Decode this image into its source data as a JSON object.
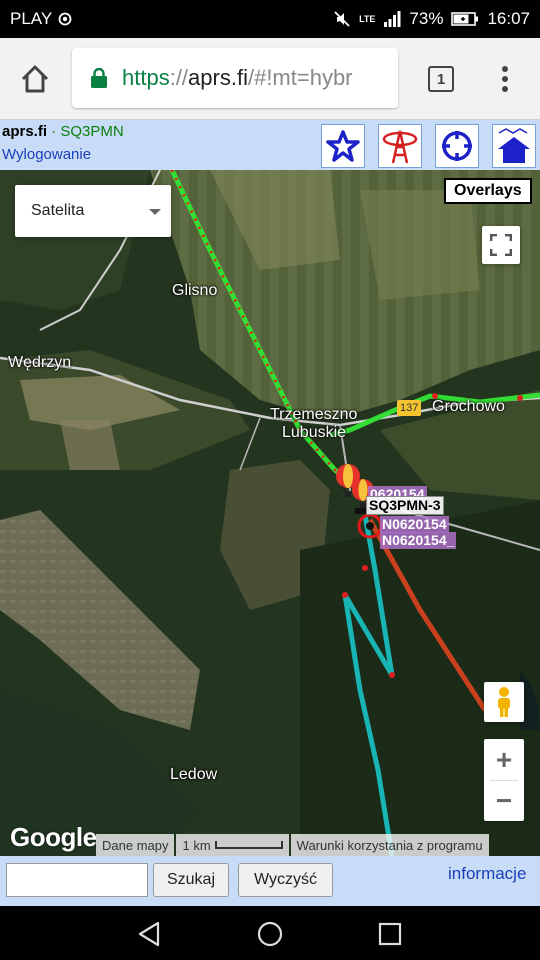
{
  "status_bar": {
    "carrier": "PLAY",
    "battery": "73%",
    "time": "16:07",
    "network": "LTE"
  },
  "browser": {
    "url_scheme": "https",
    "url_separator": "://",
    "url_host": "aprs.fi",
    "url_rest": "/#!mt=hybr",
    "tab_count": "1"
  },
  "aprs": {
    "site_name": "aprs.fi",
    "dot": " · ",
    "callsign": "SQ3PMN",
    "logout": "Wylogowanie",
    "toolbar_icons": [
      "star-icon",
      "tower-icon",
      "crosshair-icon",
      "home-icon"
    ]
  },
  "map": {
    "map_type": "Satelita",
    "overlays": "Overlays",
    "places": {
      "glisno": "Glisno",
      "wedrzyn": "Wędrzyn",
      "trzemeszno_1": "Trzemeszno",
      "trzemeszno_2": "Lubuskie",
      "grochowo": "Grochowo",
      "ledow": "Ledow"
    },
    "road_number": "137",
    "stations": {
      "label_1": "0620154",
      "label_2": "SQ3PMN-3",
      "label_3": "N0620154",
      "label_4": "N0620154_"
    },
    "zoom_in": "+",
    "zoom_out": "−",
    "google": "Google",
    "attribution": {
      "map_data": "Dane mapy",
      "scale": "1 km",
      "terms": "Warunki korzystania z programu"
    },
    "colors": {
      "green_track": "#33dd33",
      "red_dots": "#e02020",
      "teal_track": "#19b5b5",
      "orange_track": "#c8401e"
    }
  },
  "search": {
    "input_value": "",
    "search_button": "Szukaj",
    "clear_button": "Wyczyść",
    "info_link": "informacje"
  }
}
